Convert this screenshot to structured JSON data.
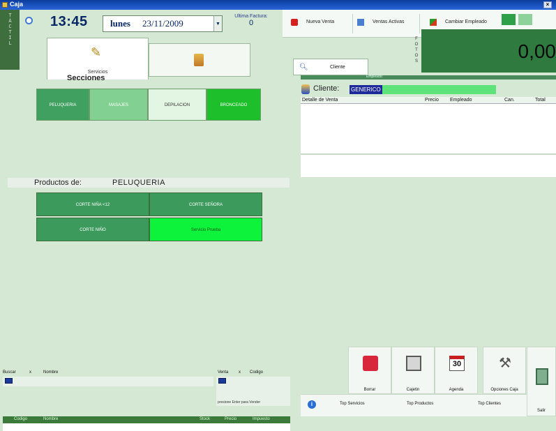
{
  "window": {
    "title": "Caja"
  },
  "vertical_tab": {
    "label": "TÁCTIL"
  },
  "header": {
    "time": "13:45",
    "day": "lunes",
    "date": "23/11/2009",
    "ultima_factura_label": "Ultima Factura:",
    "ultima_factura_value": "0"
  },
  "toolbar": {
    "nueva_venta": "Nueva Venta",
    "ventas_activas": "Ventas Activas",
    "cambiar_empleado": "Cambiar Empleado"
  },
  "tabs": {
    "servicios": "Servicios"
  },
  "cliente_tab": "Cliente",
  "fotos_label": [
    "F",
    "O",
    "T",
    "O",
    "S"
  ],
  "total": "0,00",
  "secciones": {
    "title": "Secciones",
    "items": [
      {
        "label": "PELUQUERIA",
        "color": "#3fa060"
      },
      {
        "label": "MASAJES",
        "color": "#82d192"
      },
      {
        "label": "DEPILACION",
        "color": "#e3f5e3"
      },
      {
        "label": "BRONCEADO",
        "color": "#1dbf2a"
      }
    ]
  },
  "productos": {
    "label": "Productos de:",
    "selected": "PELUQUERIA",
    "items": [
      {
        "label": "CORTE NIÑA <12",
        "color": "#3c9a5c"
      },
      {
        "label": "CORTE SEÑORA",
        "color": "#3c9a5c"
      },
      {
        "label": "CORTE NIÑO",
        "color": "#3c9a5c"
      },
      {
        "label": "Servicio Prueba",
        "color": "#0df23a"
      }
    ]
  },
  "venta": {
    "empleado_label": "Empleado:",
    "cliente_label": "Cliente:",
    "cliente_value": "GENERICO",
    "columns": [
      "Detalle de Venta",
      "Precio",
      "Empleado",
      "Can.",
      "Total"
    ]
  },
  "actions": {
    "borrar": "Borrar",
    "cajetin": "Cajetin",
    "agenda": "Agenda",
    "agenda_day": "30",
    "opciones_caja": "Opciones Caja",
    "salir": "Salir",
    "top_servicios": "Top Servicios",
    "top_productos": "Top Productos",
    "top_clientes": "Top Clientes"
  },
  "search": {
    "buscar": "Buscar",
    "x": "x",
    "nombre": "Nombre",
    "venta": "Venta",
    "codigo": "Codigo",
    "hint": "presione Enter para Vender",
    "columns": [
      "Codigo",
      "Nombre",
      "Stock",
      "Precio",
      "Impuesto"
    ]
  }
}
